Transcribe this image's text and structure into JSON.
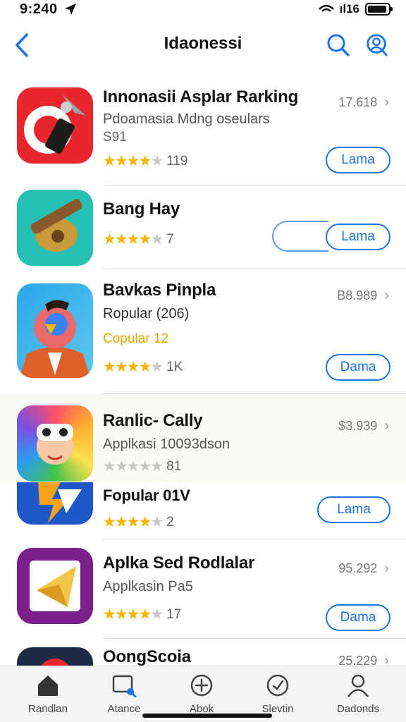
{
  "status": {
    "time": "9:240",
    "carrier": "ıl16"
  },
  "nav": {
    "title": "Idaonessi"
  },
  "apps": [
    {
      "name": "Innonasii Asplar Rarking",
      "subtitle": "Pdoamasia Mdng oseulars",
      "subtitle2": "S91",
      "stars": 4,
      "rating_count": "119",
      "price": "17.618",
      "button": "Lama"
    },
    {
      "name": "Bang Hay",
      "stars": 4,
      "rating_count": "7",
      "button": "Lama"
    },
    {
      "name": "Bavkas Pinpla",
      "subtitle": "Ropular (206)",
      "subtitle2": "Copular 12",
      "stars": 4,
      "rating_count": "1K",
      "price": "B8.989",
      "button": "Dama"
    },
    {
      "name": "Ranlic- Cally",
      "subtitle": "Applkasi 10093dson",
      "stars": 0,
      "rating_count": "81",
      "price": "$3.939"
    },
    {
      "name": "Fopular 01V",
      "stars": 4,
      "rating_count": "2",
      "button": "Lama"
    },
    {
      "name": "Aplka Sed Rodlalar",
      "subtitle": "Applkasin Pa5",
      "stars": 4,
      "rating_count": "17",
      "price": "95.292",
      "button": "Dama"
    },
    {
      "name": "OongScoia",
      "price": "25.229"
    }
  ],
  "tabs": [
    {
      "label": "Randlan",
      "icon": "home-icon"
    },
    {
      "label": "Atance",
      "icon": "search-tab-icon"
    },
    {
      "label": "Abok",
      "icon": "plus-circle-icon"
    },
    {
      "label": "Slevtin",
      "icon": "clock-icon"
    },
    {
      "label": "Dadonds",
      "icon": "profile-icon"
    }
  ],
  "colors": {
    "accent": "#1a73e8",
    "star": "#f4b400",
    "star_off": "#c7c7c7"
  }
}
